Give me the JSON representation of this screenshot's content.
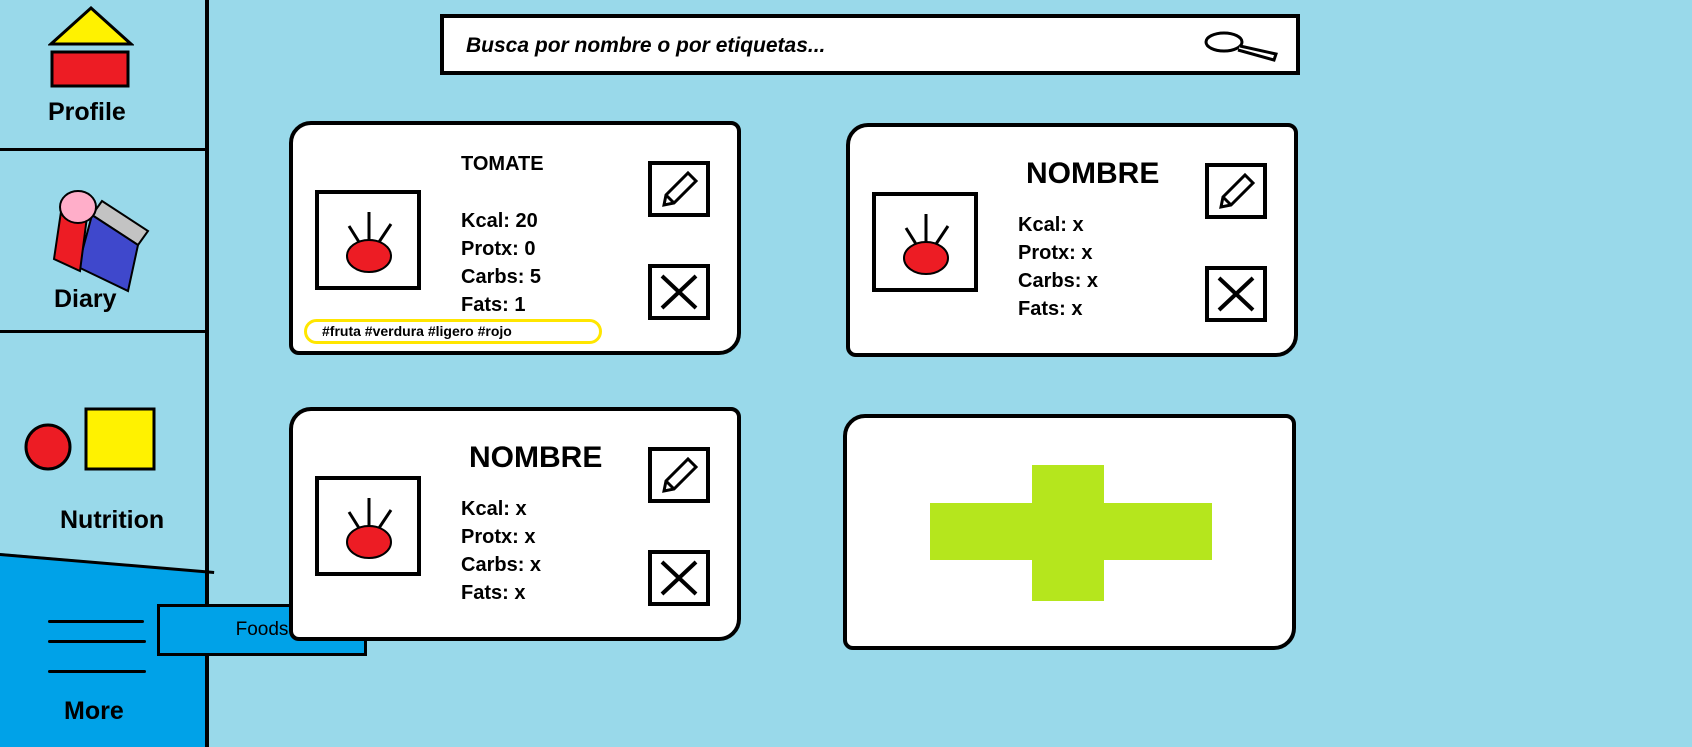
{
  "sidebar": {
    "items": [
      {
        "label": "Profile",
        "icon": "house-icon"
      },
      {
        "label": "Diary",
        "icon": "book-icon"
      },
      {
        "label": "Nutrition",
        "icon": "shapes-icon"
      },
      {
        "label": "More",
        "icon": "hamburger-menu-icon"
      }
    ],
    "submenu": {
      "foods_label": "Foods"
    }
  },
  "search": {
    "placeholder": "Busca por nombre o por etiquetas..."
  },
  "cards": [
    {
      "title": "TOMATE",
      "kcal": "Kcal: 20",
      "prot": "Protx: 0",
      "carbs": "Carbs: 5",
      "fats": "Fats: 1",
      "tags": "#fruta #verdura #ligero #rojo"
    },
    {
      "title": "NOMBRE",
      "kcal": "Kcal: x",
      "prot": "Protx: x",
      "carbs": "Carbs: x",
      "fats": "Fats: x"
    },
    {
      "title": "NOMBRE",
      "kcal": "Kcal: x",
      "prot": "Protx: x",
      "carbs": "Carbs: x",
      "fats": "Fats: x"
    }
  ],
  "colors": {
    "background": "#99d9ea",
    "more_section": "#00a2e8",
    "add_plus": "#b5e61d",
    "tag_outline": "#ffe600",
    "tomato": "#ed1c24"
  }
}
